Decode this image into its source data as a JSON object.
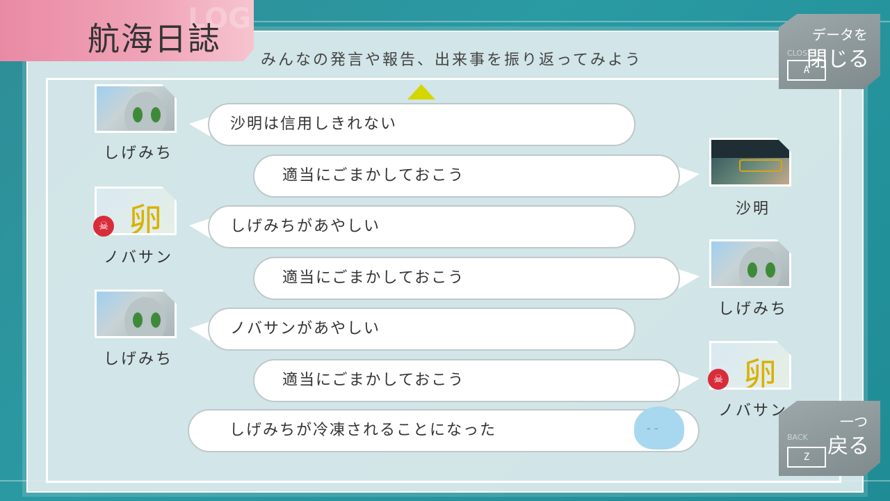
{
  "title": "航海日誌",
  "subtitle": "みんなの発言や報告、出来事を振り返ってみよう",
  "close_button": {
    "line1": "データを",
    "line2": "閉じる",
    "en": "CLOSE",
    "key": "A"
  },
  "back_button": {
    "line1": "一つ",
    "line2": "戻る",
    "en": "BACK",
    "key": "Z"
  },
  "log": [
    {
      "speaker": "しげみち",
      "text": "沙明は信用しきれない",
      "side": "left"
    },
    {
      "speaker": "沙明",
      "text": "適当にごまかしておこう",
      "side": "right"
    },
    {
      "speaker": "ノバサン",
      "text": "しげみちがあやしい",
      "side": "left"
    },
    {
      "speaker": "しげみち",
      "text": "適当にごまかしておこう",
      "side": "right"
    },
    {
      "speaker": "しげみち",
      "text": "ノバサンがあやしい",
      "side": "left"
    },
    {
      "speaker": "ノバサン",
      "text": "適当にごまかしておこう",
      "side": "right"
    },
    {
      "speaker": "",
      "text": "しげみちが冷凍されることになった",
      "side": "event"
    }
  ],
  "icons": {
    "scroll_up": "triangle-up-icon",
    "marked": "skull-mark-icon",
    "frozen": "frozen-head-icon"
  }
}
